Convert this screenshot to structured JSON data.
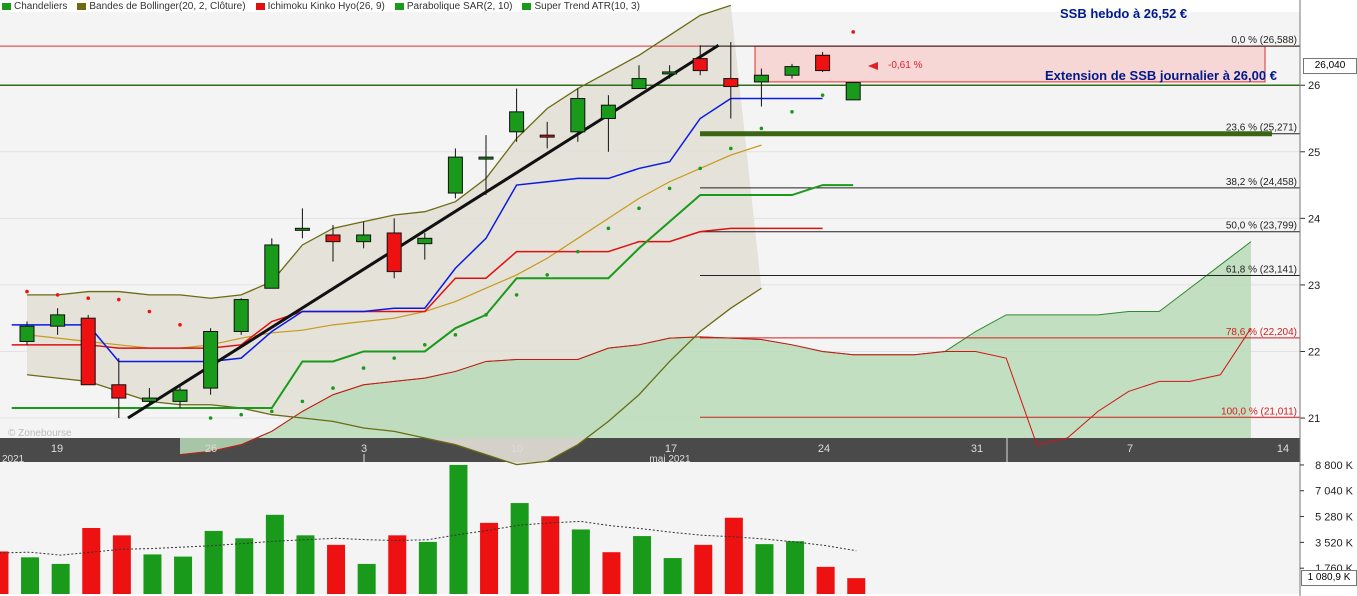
{
  "legend": [
    {
      "label": "Chandeliers",
      "color": "#1a9a1a"
    },
    {
      "label": "Bandes de Bollinger(20, 2, Clôture)",
      "color": "#6b6b14"
    },
    {
      "label": "Ichimoku Kinko Hyo(26, 9)",
      "color": "#e01010"
    },
    {
      "label": "Parabolique SAR(2, 10)",
      "color": "#1a9a1a"
    },
    {
      "label": "Super Trend ATR(10, 3)",
      "color": "#1a9a1a"
    }
  ],
  "annotations": {
    "ssb_weekly": "SSB hebdo à 26,52 €",
    "ssb_daily": "Extension de SSB journalier à 26,00 €",
    "pct_change": "-0,61 %",
    "watermark": "© Zonebourse"
  },
  "price_tag": "26,040",
  "volume_tag": "1 080,9 K",
  "colors": {
    "up": "#1a9a1a",
    "down": "#ee1111",
    "kijun": "#0a1ae6",
    "tenkan": "#e01010",
    "bollinger": "#6b6b14",
    "ma": "#c89a1a",
    "supertrend": "#1a9a1a",
    "cloud": "#b9dbb9",
    "zone": "#f7d6d6"
  },
  "chart_data": [
    {
      "type": "candlestick",
      "title": "",
      "x_tick_labels": [
        "19",
        "26",
        "3",
        "10",
        "17",
        "24",
        "31",
        "7",
        "14"
      ],
      "x_month_labels": [
        "2021",
        "mai 2021"
      ],
      "y_tick_labels": [
        "21",
        "22",
        "23",
        "24",
        "25",
        "26"
      ],
      "ylim": [
        20.7,
        27.1
      ],
      "candles": [
        {
          "o": 22.15,
          "h": 22.45,
          "l": 22.1,
          "c": 22.38
        },
        {
          "o": 22.38,
          "h": 22.65,
          "l": 22.25,
          "c": 22.55
        },
        {
          "o": 22.5,
          "h": 22.55,
          "l": 21.5,
          "c": 21.5
        },
        {
          "o": 21.5,
          "h": 21.9,
          "l": 21.0,
          "c": 21.3
        },
        {
          "o": 21.25,
          "h": 21.45,
          "l": 21.2,
          "c": 21.3
        },
        {
          "o": 21.25,
          "h": 21.5,
          "l": 21.15,
          "c": 21.42
        },
        {
          "o": 21.45,
          "h": 22.35,
          "l": 21.35,
          "c": 22.3
        },
        {
          "o": 22.3,
          "h": 22.8,
          "l": 22.25,
          "c": 22.78
        },
        {
          "o": 22.95,
          "h": 23.7,
          "l": 22.95,
          "c": 23.6
        },
        {
          "o": 23.82,
          "h": 24.15,
          "l": 23.7,
          "c": 23.85
        },
        {
          "o": 23.75,
          "h": 23.9,
          "l": 23.35,
          "c": 23.65
        },
        {
          "o": 23.65,
          "h": 23.95,
          "l": 23.55,
          "c": 23.75
        },
        {
          "o": 23.78,
          "h": 24.0,
          "l": 23.1,
          "c": 23.2
        },
        {
          "o": 23.62,
          "h": 23.78,
          "l": 23.38,
          "c": 23.7
        },
        {
          "o": 24.38,
          "h": 25.05,
          "l": 24.3,
          "c": 24.92
        },
        {
          "o": 24.9,
          "h": 25.25,
          "l": 24.35,
          "c": 24.92
        },
        {
          "o": 25.3,
          "h": 25.95,
          "l": 25.15,
          "c": 25.6
        },
        {
          "o": 25.25,
          "h": 25.45,
          "l": 25.05,
          "c": 25.23
        },
        {
          "o": 25.3,
          "h": 25.95,
          "l": 25.15,
          "c": 25.8
        },
        {
          "o": 25.5,
          "h": 25.85,
          "l": 25.0,
          "c": 25.7
        },
        {
          "o": 25.95,
          "h": 26.3,
          "l": 25.95,
          "c": 26.1
        },
        {
          "o": 26.18,
          "h": 26.3,
          "l": 26.1,
          "c": 26.2
        },
        {
          "o": 26.4,
          "h": 26.6,
          "l": 26.15,
          "c": 26.22
        },
        {
          "o": 26.1,
          "h": 26.65,
          "l": 25.5,
          "c": 25.98
        },
        {
          "o": 26.05,
          "h": 26.25,
          "l": 25.68,
          "c": 26.15
        },
        {
          "o": 26.15,
          "h": 26.32,
          "l": 26.1,
          "c": 26.28
        },
        {
          "o": 26.45,
          "h": 26.5,
          "l": 26.2,
          "c": 26.22
        },
        {
          "o": 25.78,
          "h": 26.05,
          "l": 25.78,
          "c": 26.04
        }
      ],
      "bollinger_upper": [
        22.85,
        22.85,
        22.9,
        22.9,
        22.85,
        22.85,
        22.8,
        22.85,
        23.05,
        23.6,
        23.85,
        23.95,
        24.05,
        24.1,
        24.25,
        24.6,
        25.2,
        25.65,
        25.95,
        26.2,
        26.45,
        26.75,
        27.05,
        27.2
      ],
      "bollinger_lower": [
        21.65,
        21.6,
        21.55,
        21.4,
        21.25,
        21.2,
        21.2,
        21.15,
        21.05,
        21.0,
        20.95,
        20.85,
        20.8,
        20.7,
        20.6,
        20.45,
        20.3,
        20.35,
        20.6,
        20.95,
        21.35,
        21.85,
        22.3,
        22.65,
        22.95
      ],
      "ma_line": [
        22.25,
        22.2,
        22.15,
        22.1,
        22.05,
        22.05,
        22.1,
        22.2,
        22.28,
        22.32,
        22.4,
        22.45,
        22.5,
        22.6,
        22.75,
        22.95,
        23.15,
        23.4,
        23.7,
        24.0,
        24.3,
        24.55,
        24.75,
        24.95,
        25.1
      ],
      "kijun": [
        22.4,
        22.4,
        22.4,
        21.85,
        21.85,
        21.85,
        21.85,
        21.9,
        22.3,
        22.6,
        22.6,
        22.6,
        22.65,
        22.65,
        23.25,
        23.7,
        24.5,
        24.55,
        24.6,
        24.6,
        24.75,
        24.85,
        25.5,
        25.8,
        25.8,
        25.8,
        25.8
      ],
      "tenkan": [
        22.1,
        22.1,
        22.1,
        22.05,
        22.05,
        22.05,
        22.05,
        22.1,
        22.45,
        22.6,
        22.6,
        22.6,
        22.6,
        22.6,
        23.1,
        23.1,
        23.5,
        23.5,
        23.5,
        23.5,
        23.65,
        23.65,
        23.8,
        23.85,
        23.85,
        23.85,
        23.85
      ],
      "supertrend": [
        21.15,
        21.15,
        21.15,
        21.15,
        21.15,
        21.15,
        21.15,
        21.15,
        21.15,
        21.85,
        21.85,
        22.0,
        22.0,
        22.0,
        22.35,
        22.55,
        23.1,
        23.1,
        23.1,
        23.1,
        23.55,
        23.95,
        24.35,
        24.35,
        24.35,
        24.35,
        24.5,
        24.5
      ],
      "sar": [
        22.9,
        22.85,
        22.8,
        22.78,
        22.6,
        22.4,
        21.0,
        21.05,
        21.1,
        21.25,
        21.45,
        21.75,
        21.9,
        22.1,
        22.25,
        22.55,
        22.85,
        23.15,
        23.5,
        23.85,
        24.15,
        24.45,
        24.75,
        25.05,
        25.35,
        25.6,
        25.85,
        26.8
      ],
      "ssb_cloud_top": [
        20.45,
        20.5,
        20.6,
        20.8,
        21.1,
        21.35,
        21.5,
        21.55,
        21.6,
        21.7,
        21.85,
        21.88,
        21.88,
        21.88,
        22.05,
        22.1,
        22.2,
        22.22,
        22.2,
        22.18,
        22.1,
        22.0,
        21.95,
        21.95,
        21.95,
        22.0,
        22.3,
        22.55,
        22.55,
        22.55,
        22.55,
        22.6,
        22.6,
        22.95,
        23.3,
        23.65
      ],
      "ssa_cloud_bottom": [
        20.45,
        20.5,
        20.6,
        20.8,
        21.1,
        21.35,
        21.5,
        21.55,
        21.6,
        21.7,
        21.85,
        21.88,
        21.88,
        21.88,
        22.05,
        22.1,
        22.2,
        22.22,
        22.2,
        22.18,
        22.1,
        22.0,
        21.95,
        21.95,
        21.95,
        22.0,
        22.0,
        21.9,
        20.6,
        20.7,
        21.1,
        21.4,
        21.55,
        21.55,
        21.65,
        22.35
      ],
      "fibonacci": [
        {
          "label": "0,0 % (26,588)",
          "value": 26.588
        },
        {
          "label": "23,6 % (25,271)",
          "value": 25.271
        },
        {
          "label": "38,2 % (24,458)",
          "value": 24.458
        },
        {
          "label": "50,0 % (23,799)",
          "value": 23.799
        },
        {
          "label": "61,8 % (23,141)",
          "value": 23.141
        },
        {
          "label": "78,6 % (22,204)",
          "value": 22.204
        },
        {
          "label": "100,0 % (21,011)",
          "value": 21.011
        }
      ],
      "trendline": {
        "from": 21.0,
        "to": 26.6
      },
      "support_line": 26.0,
      "ssb_weekly_level": 26.52,
      "ssb_daily_level": 26.0
    },
    {
      "type": "bar",
      "title": "",
      "y_tick_labels": [
        "8 800 K",
        "7 040 K",
        "5 280 K",
        "3 520 K",
        "1 760 K"
      ],
      "ylim": [
        0,
        9000
      ],
      "values": [
        2900,
        2500,
        2050,
        4500,
        4000,
        2700,
        2550,
        4300,
        3800,
        5400,
        4000,
        3350,
        2050,
        4000,
        3550,
        8800,
        4850,
        6200,
        5300,
        4400,
        2850,
        3950,
        2450,
        3350,
        5200,
        3400,
        3600,
        1850,
        1081
      ],
      "colors": [
        "down",
        "up",
        "up",
        "down",
        "down",
        "up",
        "up",
        "up",
        "up",
        "up",
        "up",
        "down",
        "up",
        "down",
        "up",
        "up",
        "down",
        "up",
        "down",
        "up",
        "down",
        "up",
        "up",
        "down",
        "down",
        "up",
        "up",
        "down",
        "down"
      ],
      "average": [
        2800,
        2850,
        2650,
        2850,
        3050,
        3100,
        3200,
        3300,
        3450,
        3600,
        3700,
        3800,
        3700,
        3650,
        3700,
        4050,
        4350,
        4700,
        4850,
        4950,
        4650,
        4450,
        4200,
        4000,
        3900,
        3750,
        3550,
        3300,
        2950
      ]
    }
  ]
}
